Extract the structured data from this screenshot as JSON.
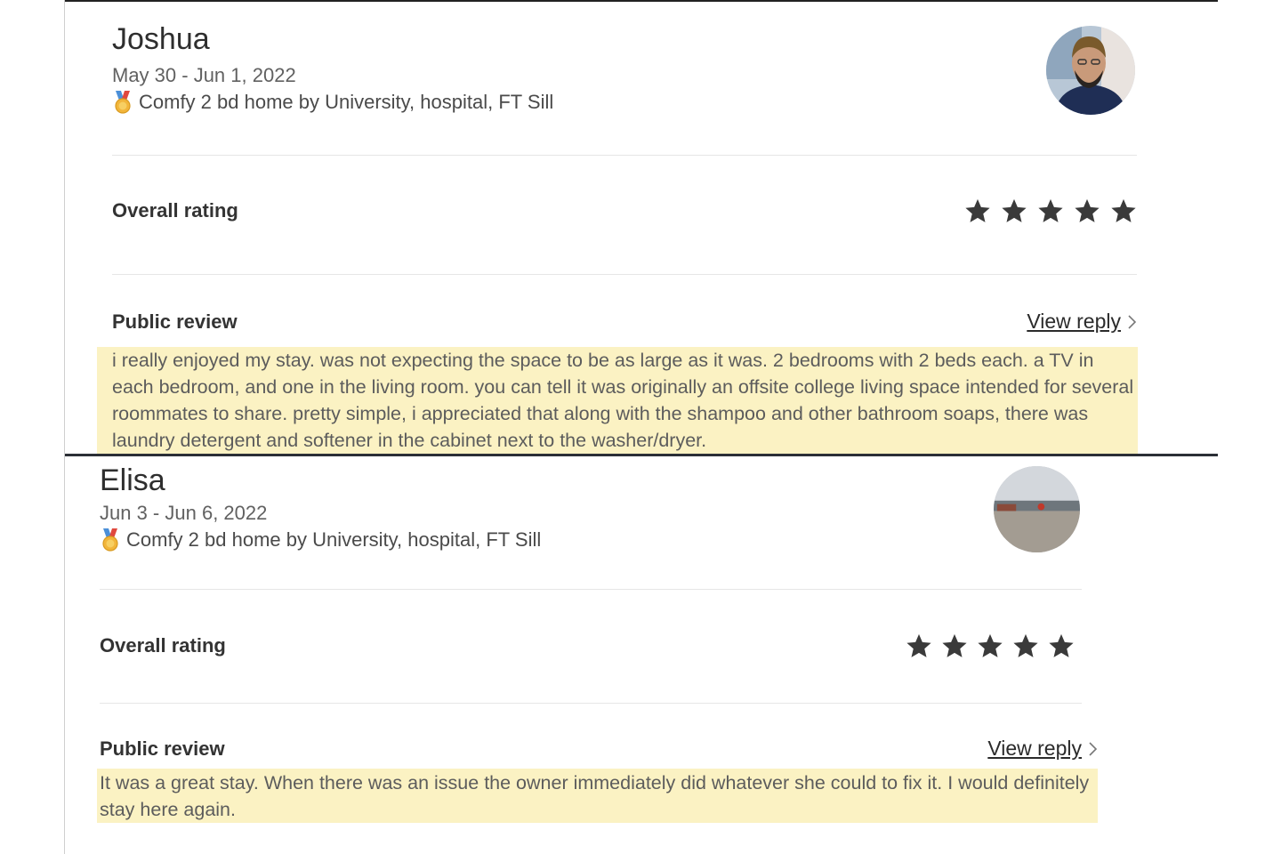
{
  "reviews": [
    {
      "guest_name": "Joshua",
      "dates": "May 30 - Jun 1, 2022",
      "listing": "Comfy 2 bd home by University, hospital, FT Sill",
      "listing_icon": "medal-icon",
      "overall_rating_label": "Overall rating",
      "rating": 5,
      "rating_max": 5,
      "public_review_label": "Public review",
      "view_reply_label": "View reply",
      "review_text": "i really enjoyed my stay. was not expecting the space to be as large as it was. 2 bedrooms with 2 beds each. a TV in each bedroom, and one in the living room. you can tell it was originally an offsite college living space intended for several roommates to share. pretty simple, i appreciated that along with the shampoo and other bathroom soaps, there was laundry detergent and softener in the cabinet next to the washer/dryer."
    },
    {
      "guest_name": "Elisa",
      "dates": "Jun 3 - Jun 6, 2022",
      "listing": "Comfy 2 bd home by University, hospital, FT Sill",
      "listing_icon": "medal-icon",
      "overall_rating_label": "Overall rating",
      "rating": 5,
      "rating_max": 5,
      "public_review_label": "Public review",
      "view_reply_label": "View reply",
      "review_text": "It was a great stay. When there was an issue the owner immediately did whatever she could to fix it. I would definitely stay here again."
    }
  ],
  "colors": {
    "highlight": "#fbf2c3",
    "star": "#3a3a3a",
    "divider": "#e6e6e6",
    "separator": "#2b2f36"
  }
}
